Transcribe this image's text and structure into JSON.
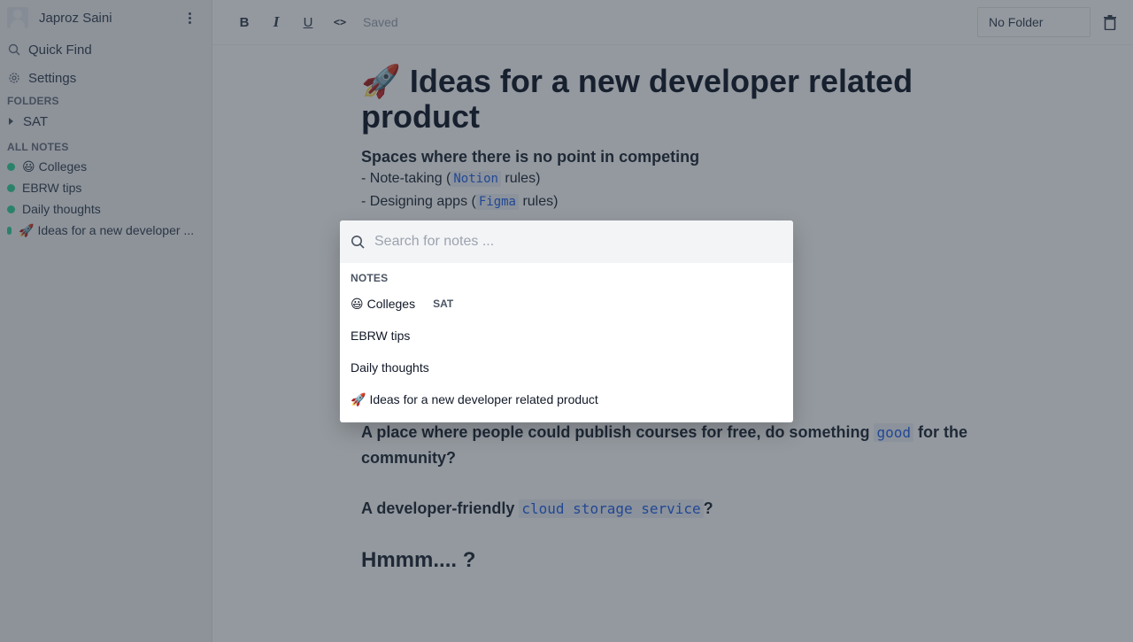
{
  "sidebar": {
    "user_name": "Japroz Saini",
    "items": [
      {
        "label": "Quick Find",
        "icon": "search-icon"
      },
      {
        "label": "Settings",
        "icon": "gear-icon"
      }
    ],
    "folders_label": "FOLDERS",
    "folders": [
      {
        "label": "SAT"
      }
    ],
    "all_notes_label": "ALL NOTES",
    "notes": [
      {
        "emoji": "😃",
        "label": "Colleges"
      },
      {
        "emoji": "",
        "label": "EBRW tips"
      },
      {
        "emoji": "",
        "label": "Daily thoughts"
      },
      {
        "emoji": "🚀",
        "label": "Ideas for a new developer ..."
      }
    ],
    "note_dot_color": "#34d399"
  },
  "toolbar": {
    "bold": "B",
    "italic": "I",
    "underline": "U",
    "code": "<>",
    "status": "Saved",
    "folder_select": "No Folder"
  },
  "editor": {
    "title_emoji": "🚀",
    "title": "Ideas for a new developer related product",
    "heading": "Spaces where there is no point in competing",
    "list": [
      {
        "prefix": "- Note-taking (",
        "code": "Notion",
        "suffix": " rules)"
      },
      {
        "prefix": "- Designing apps (",
        "code": "Figma",
        "suffix": " rules)"
      }
    ],
    "para1": {
      "prefix": "A place where people could publish courses for free, do something ",
      "code": "good",
      "suffix": " for the community?"
    },
    "para2": {
      "prefix": "A developer-friendly ",
      "code": "cloud storage service",
      "suffix": "?"
    },
    "closing": "Hmmm.... ?"
  },
  "quick_find": {
    "placeholder": "Search for notes ...",
    "value": "",
    "section_label": "NOTES",
    "results": [
      {
        "emoji": "😃",
        "label": "Colleges",
        "folder": "SAT"
      },
      {
        "emoji": "",
        "label": "EBRW tips",
        "folder": ""
      },
      {
        "emoji": "",
        "label": "Daily thoughts",
        "folder": ""
      },
      {
        "emoji": "🚀",
        "label": "Ideas for a new developer related product",
        "folder": ""
      }
    ]
  },
  "colors": {
    "accent_code": "#2563eb",
    "overlay": "rgba(31,41,55,0.48)"
  }
}
